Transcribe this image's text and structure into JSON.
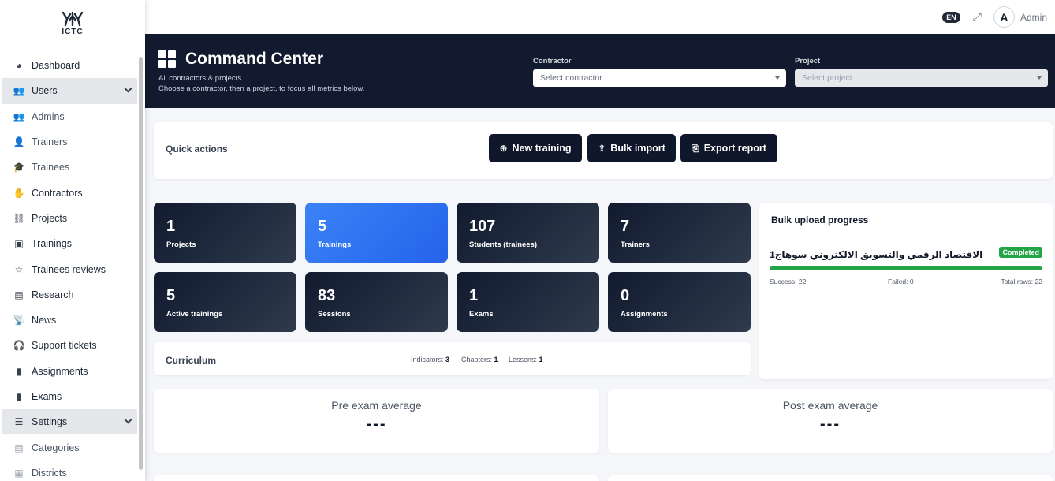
{
  "brand": {
    "logo_text": "ICTC"
  },
  "sidebar": {
    "items": [
      {
        "label": "Dashboard",
        "icon": "gauge-icon",
        "glyph": "◕",
        "kind": "item"
      },
      {
        "label": "Users",
        "icon": "users-icon",
        "glyph": "👥",
        "kind": "section"
      },
      {
        "label": "Admins",
        "icon": "users-cog-icon",
        "glyph": "👥",
        "kind": "sub"
      },
      {
        "label": "Trainers",
        "icon": "user-tie-icon",
        "glyph": "👤",
        "kind": "sub"
      },
      {
        "label": "Trainees",
        "icon": "graduation-cap-icon",
        "glyph": "🎓",
        "kind": "sub"
      },
      {
        "label": "Contractors",
        "icon": "hand-holding-icon",
        "glyph": "✋",
        "kind": "item"
      },
      {
        "label": "Projects",
        "icon": "sitemap-icon",
        "glyph": "⛓",
        "kind": "item"
      },
      {
        "label": "Trainings",
        "icon": "chalkboard-icon",
        "glyph": "▣",
        "kind": "item"
      },
      {
        "label": "Trainees reviews",
        "icon": "star-icon",
        "glyph": "☆",
        "kind": "item"
      },
      {
        "label": "Research",
        "icon": "book-icon",
        "glyph": "▤",
        "kind": "item"
      },
      {
        "label": "News",
        "icon": "broadcast-icon",
        "glyph": "📡",
        "kind": "item"
      },
      {
        "label": "Support tickets",
        "icon": "headset-icon",
        "glyph": "🎧",
        "kind": "item"
      },
      {
        "label": "Assignments",
        "icon": "file-icon",
        "glyph": "▮",
        "kind": "item"
      },
      {
        "label": "Exams",
        "icon": "file-alt-icon",
        "glyph": "▮",
        "kind": "item"
      },
      {
        "label": "Settings",
        "icon": "sliders-icon",
        "glyph": "☰",
        "kind": "section"
      },
      {
        "label": "Categories",
        "icon": "clipboard-icon",
        "glyph": "▤",
        "kind": "sub"
      },
      {
        "label": "Districts",
        "icon": "map-icon",
        "glyph": "▦",
        "kind": "sub"
      }
    ]
  },
  "topbar": {
    "language": "EN",
    "user": "Admin",
    "avatar_letter": "A"
  },
  "header": {
    "title": "Command Center",
    "subtitle_1": "All contractors & projects",
    "subtitle_2": "Choose a contractor, then a project, to focus all metrics below.",
    "contractor_label": "Contractor",
    "contractor_placeholder": "Select contractor",
    "project_label": "Project",
    "project_placeholder": "Select project"
  },
  "quick_actions": {
    "label": "Quick actions",
    "new_training": "New training",
    "bulk_import": "Bulk import",
    "export_report": "Export report"
  },
  "stats": [
    {
      "value": "1",
      "label": "Projects"
    },
    {
      "value": "5",
      "label": "Trainings"
    },
    {
      "value": "107",
      "label": "Students (trainees)"
    },
    {
      "value": "7",
      "label": "Trainers"
    },
    {
      "value": "5",
      "label": "Active trainings"
    },
    {
      "value": "83",
      "label": "Sessions"
    },
    {
      "value": "1",
      "label": "Exams"
    },
    {
      "value": "0",
      "label": "Assignments"
    }
  ],
  "curriculum": {
    "title": "Curriculum",
    "indicators_label": "Indicators:",
    "indicators": "3",
    "chapters_label": "Chapters:",
    "chapters": "1",
    "lessons_label": "Lessons:",
    "lessons": "1"
  },
  "bulk_upload": {
    "title": "Bulk upload progress",
    "item_name": "الاقتصاد الرقمي والتسويق الالكتروني سوهاج1",
    "status": "Completed",
    "progress": 1.0,
    "success": "Success: 22",
    "failed": "Failed: 0",
    "total": "Total rows: 22"
  },
  "exams": {
    "pre_title": "Pre exam average",
    "pre_value": "---",
    "post_title": "Post exam average",
    "post_value": "---"
  },
  "colors": {
    "navy": "#111a2e",
    "accent_blue": "#2563eb",
    "success_green": "#22a447"
  }
}
